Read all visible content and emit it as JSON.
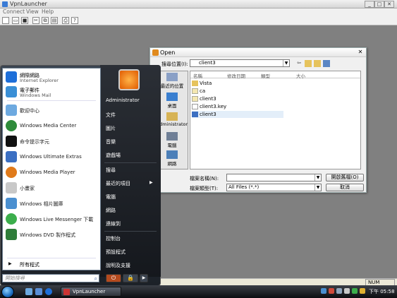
{
  "app": {
    "title": "VpnLauncher"
  },
  "menubar": [
    "Connect",
    "View",
    "Help"
  ],
  "statusbar": {
    "num": "NUM"
  },
  "dialog": {
    "title": "Open",
    "lookin_label": "搜尋位置(I):",
    "lookin_value": "client3",
    "columns": [
      "名稱",
      "修改日期",
      "類型",
      "大小"
    ],
    "places": [
      "最近的位置",
      "桌面",
      "Administrator",
      "電腦",
      "網路"
    ],
    "files": [
      {
        "name": "Vista",
        "icon": "folder-icon"
      },
      {
        "name": "ca",
        "icon": "certificate-icon"
      },
      {
        "name": "client3",
        "icon": "certificate-icon"
      },
      {
        "name": "client3.key",
        "icon": "file-icon"
      },
      {
        "name": "client3",
        "icon": "config-icon"
      }
    ],
    "filename_label": "檔案名稱(N):",
    "filename_value": "",
    "filetype_label": "檔案類型(T):",
    "filetype_value": "All Files (*.*)",
    "open_button": "開啟舊檔(O)",
    "cancel_button": "取消"
  },
  "startmenu": {
    "left_items": [
      {
        "line1": "網際網路",
        "line2": "Internet Explorer",
        "icon": "internet-explorer-icon",
        "color": "#1e6fd9"
      },
      {
        "line1": "電子郵件",
        "line2": "Windows Mail",
        "icon": "windows-mail-icon",
        "color": "#3a8fd6"
      },
      {
        "line1": "歡迎中心",
        "icon": "welcome-center-icon",
        "color": "#6da9e0"
      },
      {
        "line1": "Windows Media Center",
        "icon": "media-center-icon",
        "color": "#2e8b3a"
      },
      {
        "line1": "命令提示字元",
        "icon": "command-prompt-icon",
        "color": "#111111"
      },
      {
        "line1": "Windows Ultimate Extras",
        "icon": "ultimate-extras-icon",
        "color": "#3b6fc2"
      },
      {
        "line1": "Windows Media Player",
        "icon": "media-player-icon",
        "color": "#e07a1a"
      },
      {
        "line1": "小畫家",
        "icon": "paint-icon",
        "color": "#c8c8c8"
      },
      {
        "line1": "Windows 相片圖庫",
        "icon": "photo-gallery-icon",
        "color": "#4a8fd0"
      },
      {
        "line1": "Windows Live Messenger 下載",
        "icon": "messenger-icon",
        "color": "#3cae4c"
      },
      {
        "line1": "Windows DVD 製作程式",
        "icon": "dvd-maker-icon",
        "color": "#2f7d3a"
      }
    ],
    "all_programs": "所有程式",
    "search_placeholder": "開始搜尋",
    "right_items": [
      "Administrator",
      "文件",
      "圖片",
      "音樂",
      "遊戲場",
      "搜尋",
      "最近的項目",
      "電腦",
      "網路",
      "連線到",
      "控制台",
      "預設程式",
      "說明及支援"
    ]
  },
  "taskbar": {
    "task_label": "VpnLauncher",
    "clock": "下午 05:58"
  }
}
